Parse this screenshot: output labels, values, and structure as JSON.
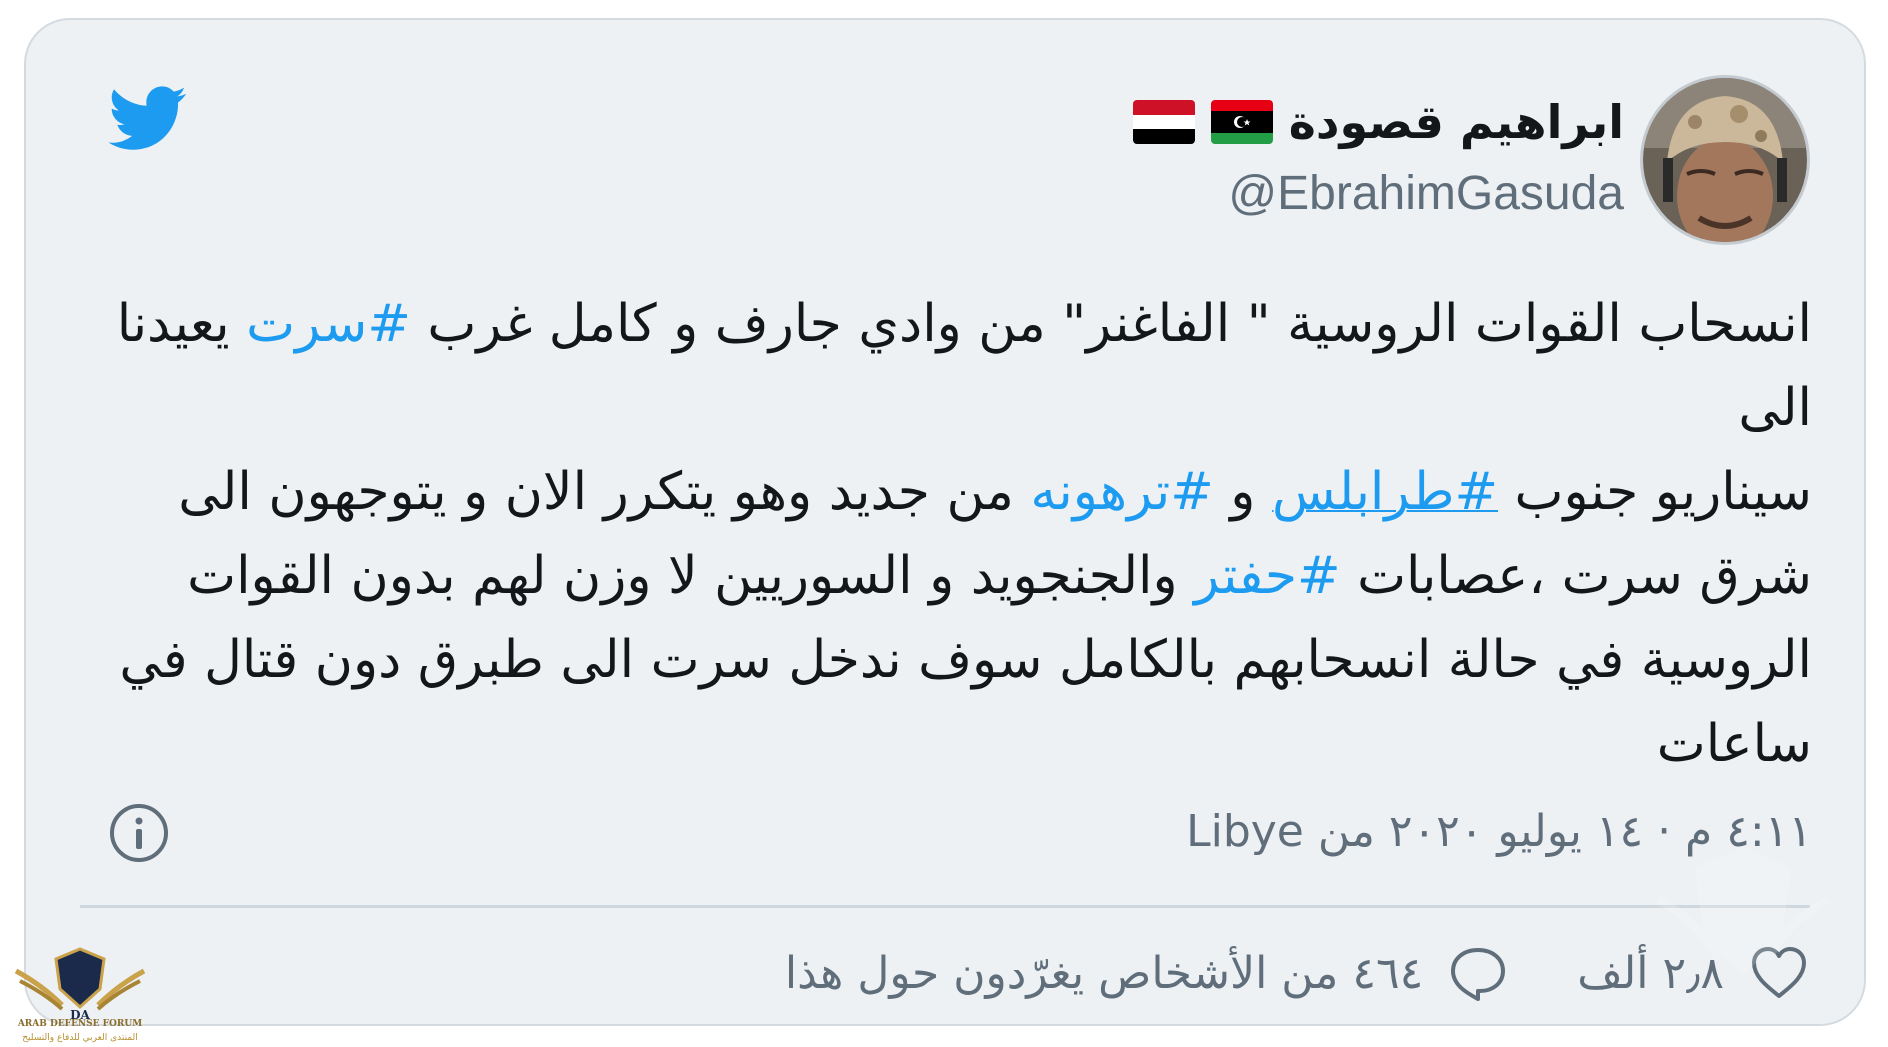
{
  "colors": {
    "card_background": "#edf1f4",
    "text": "#14171a",
    "secondary_text": "#5f6e7a",
    "link": "#1d9bf0",
    "twitter_blue": "#1d9bf0"
  },
  "header": {
    "display_name": "ابراهيم قصودة",
    "handle": "@EbrahimGasuda",
    "flags": [
      "libya-flag",
      "yemen-flag"
    ],
    "logo_icon": "twitter-bird-icon",
    "avatar_icon": "profile-avatar"
  },
  "tweet": {
    "lines": [
      {
        "before": "انسحاب القوات الروسية \" الفاغنر\" من وادي جارف و كامل غرب ",
        "tag": "#سرت",
        "after": " يعيدنا"
      },
      {
        "text": "الى"
      },
      {
        "before": "سيناريو جنوب ",
        "tag": "#طرابلس",
        "middle": " و ",
        "tag2": "#ترهونه",
        "after": " من جديد وهو يتكرر الان و يتوجهون الى"
      },
      {
        "before": "شرق سرت ،عصابات ",
        "tag": "#حفتر",
        "after": " والجنجويد و السوريين لا وزن لهم بدون القوات"
      },
      {
        "text": "الروسية في حالة انسحابهم بالكامل سوف ندخل سرت الى طبرق دون قتال في"
      },
      {
        "text": "ساعات"
      }
    ]
  },
  "meta": {
    "timestamp": "٤:١١ م · ١٤ يوليو ٢٠٢٠ من Libye",
    "info_icon": "info-icon"
  },
  "actions": {
    "likes": "٢٫٨ ألف",
    "like_icon": "heart-icon",
    "discussion": "٤٦٤ من الأشخاص يغرّدون حول هذا",
    "reply_icon": "chat-bubble-icon"
  },
  "watermark": {
    "line1": "ARAB DEFENSE FORUM",
    "line2": "المنتدى العربي للدفاع والتسليح",
    "mark": "DA"
  }
}
